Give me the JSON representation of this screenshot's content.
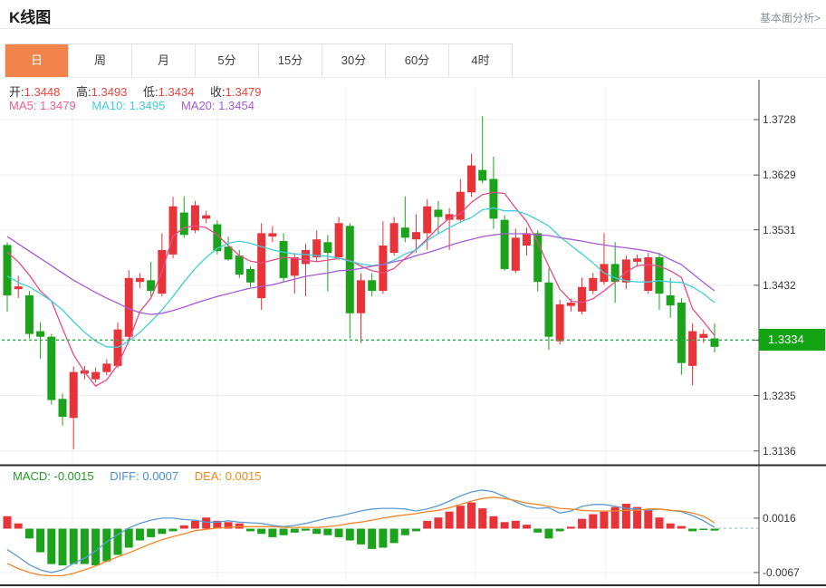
{
  "header": {
    "title": "K线图",
    "link_label": "基本面分析>"
  },
  "tabs": {
    "active_index": 0,
    "items": [
      "日",
      "周",
      "月",
      "5分",
      "15分",
      "30分",
      "60分",
      "4时"
    ]
  },
  "ohlc_legend": {
    "open_label": "开:",
    "open": "1.3448",
    "high_label": "高:",
    "high": "1.3493",
    "low_label": "低:",
    "low": "1.3434",
    "close_label": "收:",
    "close": "1.3479"
  },
  "ma_legend": {
    "items": [
      {
        "label": "MA5:",
        "value": "1.3479",
        "color": "#e8638f"
      },
      {
        "label": "MA10:",
        "value": "1.3495",
        "color": "#3fcfdc"
      },
      {
        "label": "MA20:",
        "value": "1.3454",
        "color": "#a75cd8"
      }
    ]
  },
  "macd_legend": {
    "items": [
      {
        "label": "MACD:",
        "value": "-0.0015",
        "color": "#259b25"
      },
      {
        "label": "DIFF:",
        "value": "0.0007",
        "color": "#4a90dd"
      },
      {
        "label": "DEA:",
        "value": "0.0015",
        "color": "#f28a1e"
      }
    ]
  },
  "palette": {
    "up_red": "#e83438",
    "down_green": "#1ba31b",
    "tab_accent": "#f1834b",
    "price_tag_green": "#12a412",
    "dotted_line_green": "#2fae4f",
    "ma5": "#e84b86",
    "ma10": "#3fcfdc",
    "ma20": "#a75cd8",
    "diff_blue": "#5b9bd5",
    "dea_orange": "#f0882a"
  },
  "chart_data": {
    "type": "candlestick",
    "title": "K线图 daily candles with MA5/MA10/MA20 and MACD sub-chart",
    "y_axis": {
      "ticks": [
        "1.3728",
        "1.3629",
        "1.3531",
        "1.3432",
        "1.3334",
        "1.3235",
        "1.3136"
      ]
    },
    "current_price": {
      "value": "1.3334"
    },
    "candles_ohlc": [
      [
        1.3504,
        1.3509,
        1.3385,
        1.3414
      ],
      [
        1.3425,
        1.3449,
        1.3409,
        1.343
      ],
      [
        1.3414,
        1.3422,
        1.3337,
        1.3345
      ],
      [
        1.335,
        1.3366,
        1.3301,
        1.334
      ],
      [
        1.334,
        1.3345,
        1.3219,
        1.3227
      ],
      [
        1.3229,
        1.3239,
        1.3181,
        1.3197
      ],
      [
        1.3195,
        1.3287,
        1.3139,
        1.3277
      ],
      [
        1.3274,
        1.3288,
        1.3264,
        1.328
      ],
      [
        1.3264,
        1.3285,
        1.3258,
        1.3277
      ],
      [
        1.3277,
        1.33,
        1.3271,
        1.3292
      ],
      [
        1.3288,
        1.3366,
        1.3284,
        1.3353
      ],
      [
        1.334,
        1.3459,
        1.3332,
        1.3445
      ],
      [
        1.3438,
        1.3454,
        1.3427,
        1.3445
      ],
      [
        1.3441,
        1.3474,
        1.3412,
        1.3422
      ],
      [
        1.3417,
        1.3525,
        1.3412,
        1.3495
      ],
      [
        1.3487,
        1.359,
        1.348,
        1.3573
      ],
      [
        1.3562,
        1.3591,
        1.3517,
        1.3522
      ],
      [
        1.353,
        1.3583,
        1.3525,
        1.3575
      ],
      [
        1.3551,
        1.3565,
        1.3543,
        1.3557
      ],
      [
        1.3541,
        1.3548,
        1.3487,
        1.3493
      ],
      [
        1.3501,
        1.3519,
        1.3476,
        1.3478
      ],
      [
        1.3485,
        1.3495,
        1.3445,
        1.3451
      ],
      [
        1.3461,
        1.3466,
        1.3429,
        1.3437
      ],
      [
        1.3409,
        1.3543,
        1.3388,
        1.3525
      ],
      [
        1.3519,
        1.3538,
        1.3509,
        1.3525
      ],
      [
        1.3511,
        1.3525,
        1.3438,
        1.3445
      ],
      [
        1.3449,
        1.349,
        1.3417,
        1.3482
      ],
      [
        1.347,
        1.3506,
        1.3412,
        1.3495
      ],
      [
        1.3482,
        1.353,
        1.3474,
        1.3514
      ],
      [
        1.3509,
        1.3522,
        1.3421,
        1.349
      ],
      [
        1.3482,
        1.3554,
        1.3477,
        1.3543
      ],
      [
        1.3538,
        1.3543,
        1.3337,
        1.3382
      ],
      [
        1.3382,
        1.3453,
        1.3329,
        1.3441
      ],
      [
        1.3441,
        1.3454,
        1.3412,
        1.3422
      ],
      [
        1.3422,
        1.3546,
        1.3417,
        1.3503
      ],
      [
        1.349,
        1.3554,
        1.3485,
        1.3543
      ],
      [
        1.3535,
        1.3591,
        1.3509,
        1.3517
      ],
      [
        1.3514,
        1.3559,
        1.349,
        1.3527
      ],
      [
        1.3525,
        1.3586,
        1.3495,
        1.3573
      ],
      [
        1.3567,
        1.3583,
        1.3525,
        1.3554
      ],
      [
        1.3549,
        1.357,
        1.3495,
        1.3559
      ],
      [
        1.3549,
        1.3622,
        1.3543,
        1.3599
      ],
      [
        1.3598,
        1.3667,
        1.359,
        1.3646
      ],
      [
        1.3638,
        1.3734,
        1.3614,
        1.3619
      ],
      [
        1.3622,
        1.3662,
        1.3533,
        1.3551
      ],
      [
        1.3549,
        1.3557,
        1.3458,
        1.3461
      ],
      [
        1.3458,
        1.3533,
        1.3454,
        1.3517
      ],
      [
        1.3503,
        1.3535,
        1.3485,
        1.3525
      ],
      [
        1.3525,
        1.353,
        1.3421,
        1.3438
      ],
      [
        1.3437,
        1.3462,
        1.3317,
        1.334
      ],
      [
        1.3332,
        1.3406,
        1.3326,
        1.3398
      ],
      [
        1.3395,
        1.3409,
        1.3385,
        1.3401
      ],
      [
        1.3385,
        1.3446,
        1.338,
        1.3429
      ],
      [
        1.3422,
        1.3454,
        1.3416,
        1.3445
      ],
      [
        1.3438,
        1.3525,
        1.3433,
        1.347
      ],
      [
        1.347,
        1.3509,
        1.3401,
        1.3438
      ],
      [
        1.3437,
        1.3485,
        1.3425,
        1.3478
      ],
      [
        1.3474,
        1.3487,
        1.3466,
        1.348
      ],
      [
        1.3422,
        1.349,
        1.3417,
        1.3482
      ],
      [
        1.3482,
        1.349,
        1.3388,
        1.3417
      ],
      [
        1.3414,
        1.3445,
        1.3374,
        1.3396
      ],
      [
        1.3401,
        1.3409,
        1.3272,
        1.3293
      ],
      [
        1.3288,
        1.3364,
        1.3253,
        1.335
      ],
      [
        1.3338,
        1.3353,
        1.3329,
        1.3345
      ],
      [
        1.3337,
        1.3364,
        1.3312,
        1.3322
      ]
    ],
    "ma5": [
      1.3491,
      1.3474,
      1.345,
      1.3422,
      1.3404,
      1.3355,
      1.3308,
      1.3277,
      1.3252,
      1.3263,
      1.329,
      1.3332,
      1.3385,
      1.3409,
      1.3456,
      1.352,
      1.3535,
      1.3538,
      1.3535,
      1.3522,
      1.3503,
      1.3485,
      1.3475,
      1.3472,
      1.3477,
      1.3482,
      1.348,
      1.3477,
      1.3474,
      1.3477,
      1.348,
      1.3477,
      1.3466,
      1.3458,
      1.3454,
      1.3462,
      1.348,
      1.3496,
      1.3515,
      1.3535,
      1.3552,
      1.356,
      1.358,
      1.3594,
      1.3598,
      1.3596,
      1.357,
      1.3546,
      1.3509,
      1.3466,
      1.3425,
      1.3404,
      1.3401,
      1.3408,
      1.3422,
      1.3438,
      1.3456,
      1.3467,
      1.3469,
      1.3466,
      1.3458,
      1.3446,
      1.339,
      1.3367,
      1.3342
    ],
    "ma10": [
      1.3449,
      1.3437,
      1.3429,
      1.3417,
      1.3404,
      1.3388,
      1.3367,
      1.3348,
      1.3332,
      1.3322,
      1.3321,
      1.3332,
      1.3348,
      1.3367,
      1.3388,
      1.3412,
      1.3438,
      1.3462,
      1.3482,
      1.3498,
      1.3507,
      1.3511,
      1.3507,
      1.3501,
      1.3495,
      1.3491,
      1.3488,
      1.3487,
      1.3485,
      1.3484,
      1.348,
      1.3475,
      1.347,
      1.3467,
      1.3469,
      1.3477,
      1.3488,
      1.3495,
      1.3512,
      1.3524,
      1.3535,
      1.3545,
      1.3553,
      1.3567,
      1.357,
      1.3565,
      1.3565,
      1.3559,
      1.3549,
      1.3538,
      1.3519,
      1.3503,
      1.3488,
      1.3472,
      1.3454,
      1.3445,
      1.344,
      1.3438,
      1.3438,
      1.344,
      1.3438,
      1.3437,
      1.3429,
      1.3417,
      1.3401
    ],
    "ma20": [
      1.3519,
      1.3506,
      1.3493,
      1.348,
      1.3467,
      1.3454,
      1.3441,
      1.343,
      1.3419,
      1.3409,
      1.34,
      1.339,
      1.3383,
      1.338,
      1.3382,
      1.3387,
      1.3393,
      1.34,
      1.3406,
      1.3412,
      1.3417,
      1.3422,
      1.3427,
      1.343,
      1.3433,
      1.3438,
      1.3443,
      1.3448,
      1.3451,
      1.3454,
      1.3458,
      1.3459,
      1.3462,
      1.3466,
      1.3469,
      1.3474,
      1.3478,
      1.3485,
      1.349,
      1.3496,
      1.3503,
      1.3509,
      1.3514,
      1.3519,
      1.3522,
      1.3524,
      1.3524,
      1.3524,
      1.3522,
      1.3521,
      1.3517,
      1.3514,
      1.3511,
      1.3507,
      1.3504,
      1.3501,
      1.3499,
      1.3496,
      1.3493,
      1.3488,
      1.3478,
      1.3469,
      1.3453,
      1.3437,
      1.3422
    ],
    "macd": {
      "y_ticks": [
        {
          "label": "0.0016",
          "value": 0.0016
        },
        {
          "label": "-0.0067",
          "value": -0.0067
        }
      ],
      "histogram": [
        0.0019,
        0.0008,
        -0.0015,
        -0.0036,
        -0.0054,
        -0.0056,
        -0.0054,
        -0.0054,
        -0.0056,
        -0.005,
        -0.004,
        -0.0029,
        -0.0018,
        -0.0013,
        -0.0008,
        -0.0004,
        0.0005,
        0.0012,
        0.0017,
        0.0012,
        0.001,
        0.0008,
        -0.0004,
        -0.0008,
        -0.0013,
        -0.001,
        -0.0006,
        -0.0003,
        -0.0008,
        -0.001,
        -0.0013,
        -0.0018,
        -0.0024,
        -0.0031,
        -0.0029,
        -0.0022,
        -0.001,
        -0.0004,
        0.0012,
        0.0017,
        0.0026,
        0.0035,
        0.004,
        0.0031,
        0.0019,
        0.001,
        0.0012,
        0.0006,
        -0.0006,
        -0.0015,
        -0.0004,
        0.0003,
        0.0015,
        0.0022,
        0.0026,
        0.0033,
        0.0038,
        0.0033,
        0.0029,
        0.0017,
        0.0008,
        0.0004,
        -0.0004,
        -0.0002,
        -0.0003
      ],
      "diff": [
        -0.0032,
        -0.0043,
        -0.0055,
        -0.0063,
        -0.0067,
        -0.0063,
        -0.0053,
        -0.0045,
        -0.0034,
        -0.002,
        -0.0009,
        0.0001,
        0.0008,
        0.0013,
        0.0016,
        0.0016,
        0.0014,
        0.0013,
        0.001,
        0.001,
        0.0012,
        0.001,
        0.0009,
        0.0008,
        0.0005,
        0.0003,
        0.0005,
        0.0008,
        0.0012,
        0.0016,
        0.0019,
        0.0023,
        0.0027,
        0.003,
        0.0031,
        0.0031,
        0.003,
        0.0027,
        0.003,
        0.0035,
        0.0042,
        0.005,
        0.0056,
        0.0059,
        0.0056,
        0.0049,
        0.0041,
        0.0034,
        0.0031,
        0.0032,
        0.0024,
        0.0027,
        0.0034,
        0.0037,
        0.0037,
        0.0034,
        0.0031,
        0.003,
        0.0028,
        0.003,
        0.0028,
        0.0026,
        0.002,
        0.0012,
        0.0002
      ],
      "dea": [
        -0.0053,
        -0.0061,
        -0.0067,
        -0.0071,
        -0.0072,
        -0.0072,
        -0.0068,
        -0.0063,
        -0.0057,
        -0.005,
        -0.0043,
        -0.0037,
        -0.003,
        -0.0023,
        -0.0017,
        -0.0012,
        -0.0008,
        -0.0003,
        -0.0001,
        0.0001,
        0.0002,
        0.0003,
        0.0003,
        0.0003,
        0.0003,
        0.0002,
        0.0002,
        0.0002,
        0.0002,
        0.0003,
        0.0005,
        0.0008,
        0.001,
        0.0013,
        0.0016,
        0.0019,
        0.0021,
        0.0023,
        0.0026,
        0.0028,
        0.0032,
        0.0037,
        0.0042,
        0.0046,
        0.0048,
        0.0046,
        0.0043,
        0.0039,
        0.0037,
        0.0034,
        0.0031,
        0.003,
        0.0028,
        0.0027,
        0.0027,
        0.0027,
        0.0028,
        0.0028,
        0.003,
        0.003,
        0.0028,
        0.0027,
        0.0024,
        0.0019,
        0.0009
      ]
    }
  }
}
